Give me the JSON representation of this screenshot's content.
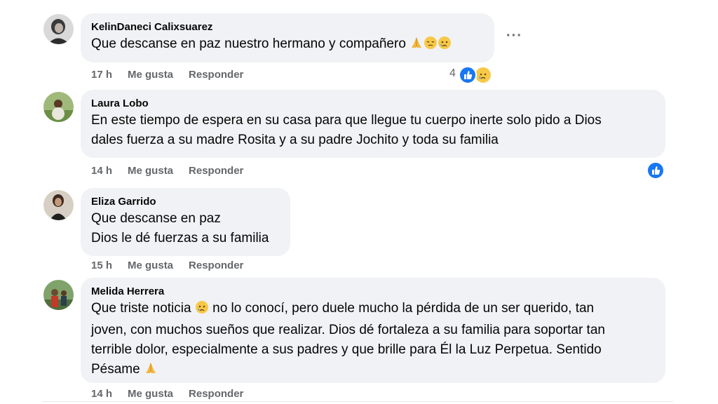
{
  "comments": [
    {
      "author": "KelinDaneci Calixsuarez",
      "lines": [
        "Que descanse en paz nuestro hermano y compañero"
      ],
      "time": "17 h",
      "like_label": "Me gusta",
      "reply_label": "Responder",
      "reaction_count": "4"
    },
    {
      "author": "Laura Lobo",
      "lines": [
        "En este tiempo de espera en su casa para que llegue tu cuerpo inerte solo pido a Dios",
        "dales fuerza a su madre Rosita y a su padre Jochito y toda su familia"
      ],
      "time": "14 h",
      "like_label": "Me gusta",
      "reply_label": "Responder"
    },
    {
      "author": "Eliza Garrido",
      "lines": [
        "Que descanse en paz",
        "Dios le dé fuerzas a su familia"
      ],
      "time": "15 h",
      "like_label": "Me gusta",
      "reply_label": "Responder"
    },
    {
      "author": "Melida Herrera",
      "lines": [
        "Que triste noticia",
        "no lo conocí, pero duele mucho la pérdida de un ser querido, tan",
        "joven, con muchos sueños que realizar. Dios dé fortaleza a su familia para soportar tan",
        "terrible dolor, especialmente a sus padres y que brille para Él la Luz Perpetua. Sentido",
        "Pésame"
      ],
      "time": "14 h",
      "like_label": "Me gusta",
      "reply_label": "Responder"
    }
  ],
  "more_label": "···",
  "colors": {
    "bubble": "#f0f2f5",
    "meta": "#65676b",
    "like_blue": "#1877f2"
  }
}
